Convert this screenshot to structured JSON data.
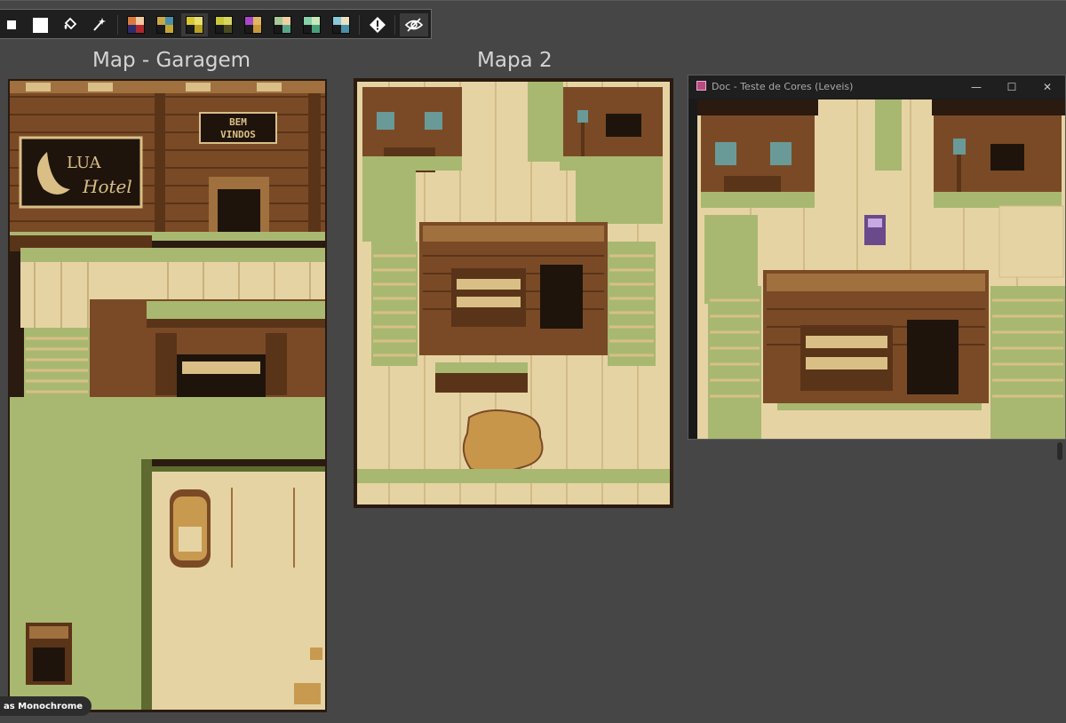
{
  "toolbar": {
    "tools": [
      {
        "name": "small-square-icon"
      },
      {
        "name": "white-square-icon"
      },
      {
        "name": "bucket-fill-icon"
      },
      {
        "name": "magic-wand-icon"
      }
    ],
    "palettes": [
      {
        "colors": [
          "#d9793f",
          "#f2c9a0",
          "#2c2c6e",
          "#b0282f"
        ]
      },
      {
        "colors": [
          "#caa843",
          "#4a8fa8",
          "#1a1a1a",
          "#c8a62f"
        ]
      },
      {
        "colors": [
          "#d8c830",
          "#e8e070",
          "#1a1a1a",
          "#b8a020"
        ]
      },
      {
        "colors": [
          "#c8c838",
          "#d8d860",
          "#1a1a1a",
          "#4a4a20"
        ]
      },
      {
        "colors": [
          "#a848c8",
          "#e0b860",
          "#1a1a1a",
          "#c89838"
        ]
      },
      {
        "colors": [
          "#a8c898",
          "#f0d0a0",
          "#1a1a1a",
          "#58a888"
        ]
      },
      {
        "colors": [
          "#88d0a8",
          "#c8e8b8",
          "#1a1a1a",
          "#48a078"
        ]
      },
      {
        "colors": [
          "#88c8d8",
          "#e8e0c0",
          "#1a1a1a",
          "#4890a8"
        ]
      }
    ],
    "right_tools": [
      {
        "name": "warning-diamond-icon"
      },
      {
        "name": "eye-hidden-icon"
      }
    ]
  },
  "panels": {
    "map1_title": "Map - Garagem",
    "map2_title": "Mapa 2"
  },
  "map1": {
    "sign_main_1": "LUA",
    "sign_main_2": "Hotel",
    "sign_welcome_1": "BEM",
    "sign_welcome_2": "VINDOS"
  },
  "doc_window": {
    "title": "Doc - Teste de Cores (Leveis)",
    "minimize": "—",
    "maximize": "☐",
    "close": "✕"
  },
  "status": {
    "text": "as Monochrome"
  },
  "colors": {
    "dark": "#2a1a10",
    "brown": "#7a4a26",
    "midbrown": "#a0703e",
    "tan": "#e6d3a3",
    "sand": "#d9bf86",
    "green": "#a8b870",
    "darkgreen": "#5e6a30",
    "teal": "#6a9a98"
  }
}
